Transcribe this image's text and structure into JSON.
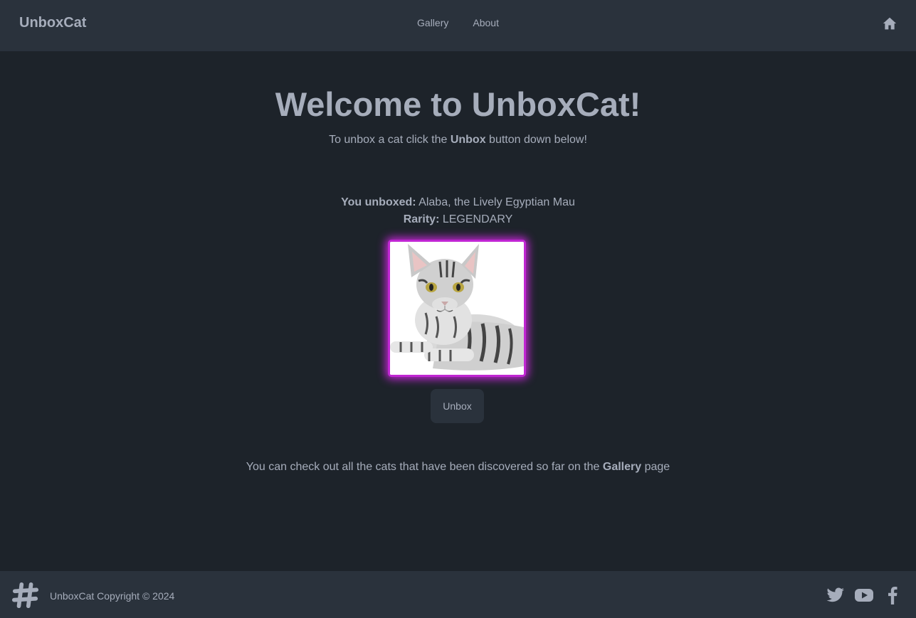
{
  "header": {
    "brand": "UnboxCat",
    "nav": [
      "Gallery",
      "About"
    ],
    "home_icon": "home-icon"
  },
  "main": {
    "title": "Welcome to UnboxCat!",
    "subtitle_prefix": "To unbox a cat click the ",
    "subtitle_bold": "Unbox",
    "subtitle_suffix": " button down below!",
    "unboxed_label": "You unboxed:",
    "unboxed_value": " Alaba, the Lively Egyptian Mau",
    "rarity_label": "Rarity:",
    "rarity_value": " LEGENDARY",
    "rarity_color": "#c026d3",
    "unbox_button": "Unbox",
    "gallery_prefix": "You can check out all the cats that have been discovered so far on the ",
    "gallery_bold": "Gallery",
    "gallery_suffix": " page"
  },
  "footer": {
    "copyright": "UnboxCat Copyright © 2024",
    "logo_icon": "hashtag-logo-icon",
    "social": [
      "twitter-icon",
      "youtube-icon",
      "facebook-icon"
    ]
  }
}
